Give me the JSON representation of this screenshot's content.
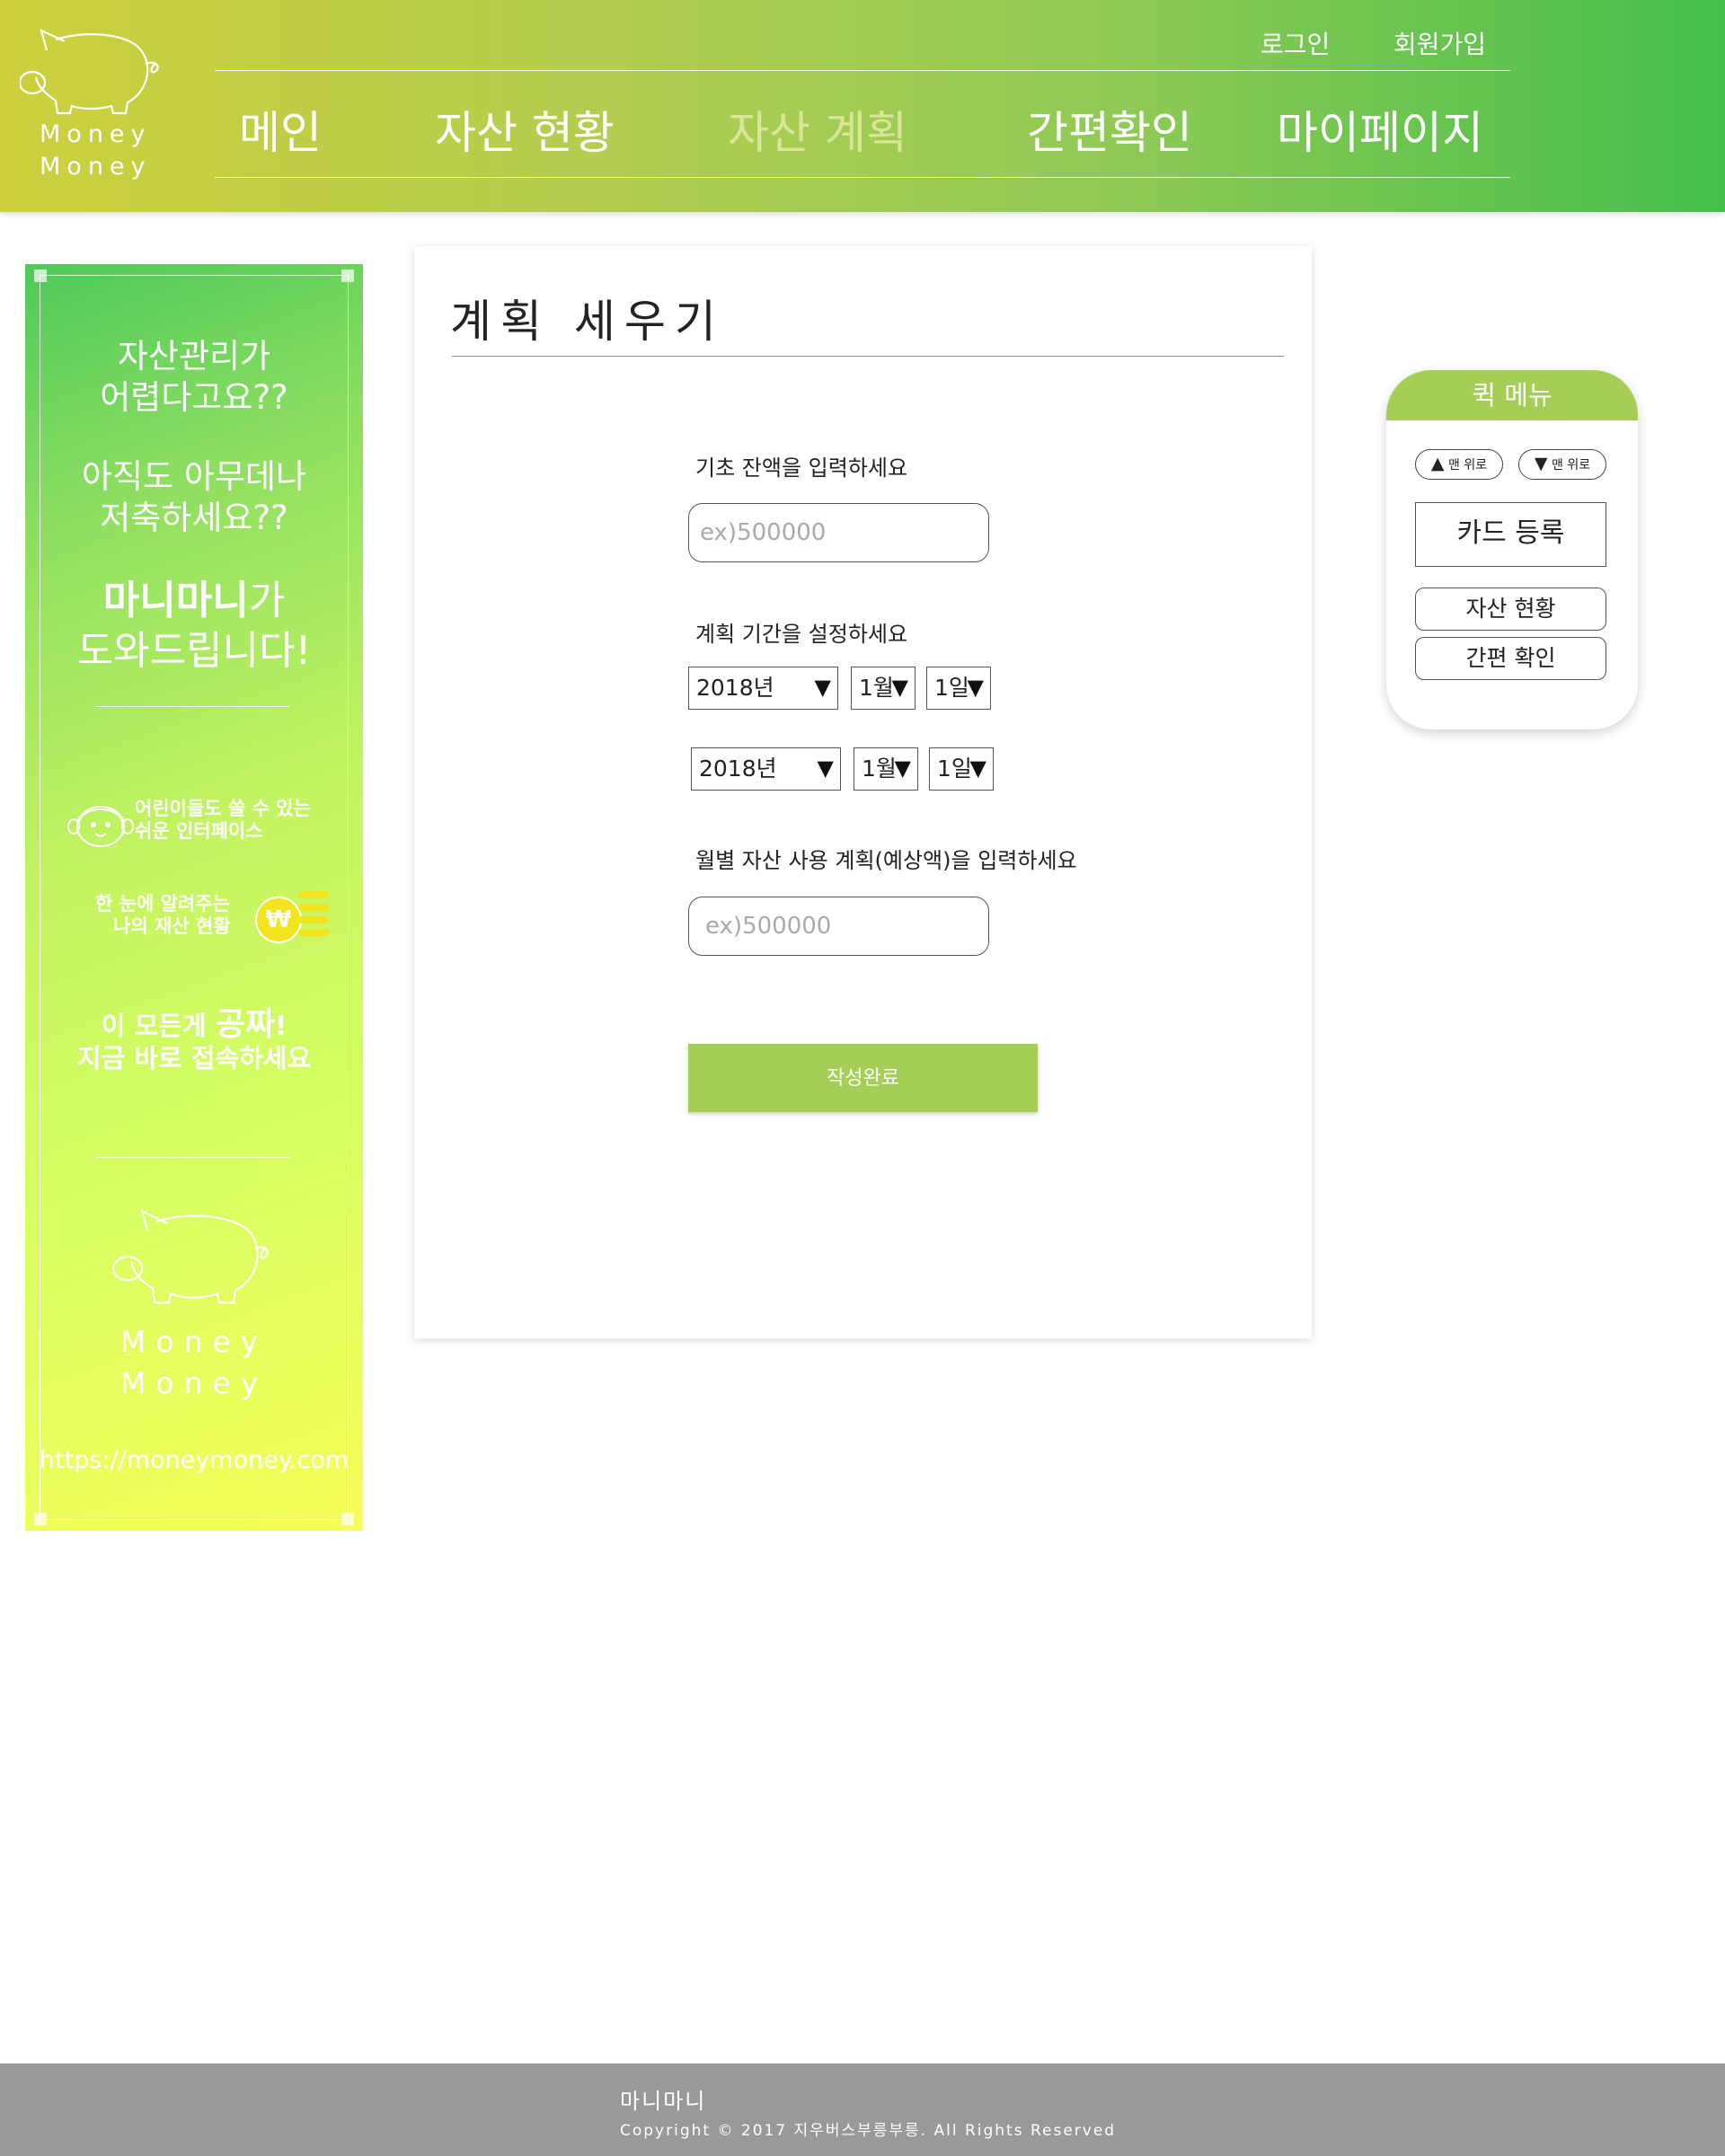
{
  "header": {
    "logo_text": [
      "Money",
      "Money"
    ],
    "auth": {
      "login": "로그인",
      "signup": "회원가입"
    },
    "nav": [
      {
        "label": "메인",
        "active": false
      },
      {
        "label": "자산 현황",
        "active": false
      },
      {
        "label": "자산 계획",
        "active": true
      },
      {
        "label": "간편확인",
        "active": false
      },
      {
        "label": "마이페이지",
        "active": false
      }
    ]
  },
  "banner": {
    "line1": "자산관리가",
    "line2": "어렵다고요??",
    "line3": "아직도 아무데나",
    "line4": "저축하세요??",
    "brand": "마니마니",
    "brand_suffix": "가",
    "line6": "도와드립니다!",
    "feature1_line1": "어린이들도 쓸 수 있는",
    "feature1_line2": "쉬운 인터페이스",
    "feature2_line1": "한 눈에 알려주는",
    "feature2_line2": "나의 재산 현황",
    "coin_symbol": "₩",
    "free_prefix": "이 모든게 ",
    "free_word": "공짜",
    "free_suffix": "!",
    "free_line2": "지금 바로 접속하세요",
    "money_line1": "Money",
    "money_line2": "Money",
    "url": "https://moneymoney.com"
  },
  "form": {
    "title": "계획 세우기",
    "balance_label": "기초 잔액을 입력하세요",
    "balance_placeholder": "ex)500000",
    "period_label": "계획 기간을 설정하세요",
    "start": {
      "year": "2018년",
      "month": "1월",
      "day": "1일"
    },
    "end": {
      "year": "2018년",
      "month": "1월",
      "day": "1일"
    },
    "monthly_label": "월별 자산 사용 계획(예상액)을 입력하세요",
    "monthly_placeholder": "ex)500000",
    "submit_label": "작성완료"
  },
  "quick_menu": {
    "title": "퀵 메뉴",
    "top_button": "맨 위로",
    "bottom_button": "맨 위로",
    "card_register": "카드 등록",
    "asset_status": "자산 현황",
    "quick_check": "간편 확인"
  },
  "footer": {
    "title": "마니마니",
    "copyright": "Copyright © 2017 지우버스부릉부릉. All Rights Reserved"
  },
  "colors": {
    "header_gradient_start": "#cdd03c",
    "header_gradient_end": "#45bf4b",
    "accent_green": "#a5ce56",
    "footer_gray": "#999999"
  }
}
